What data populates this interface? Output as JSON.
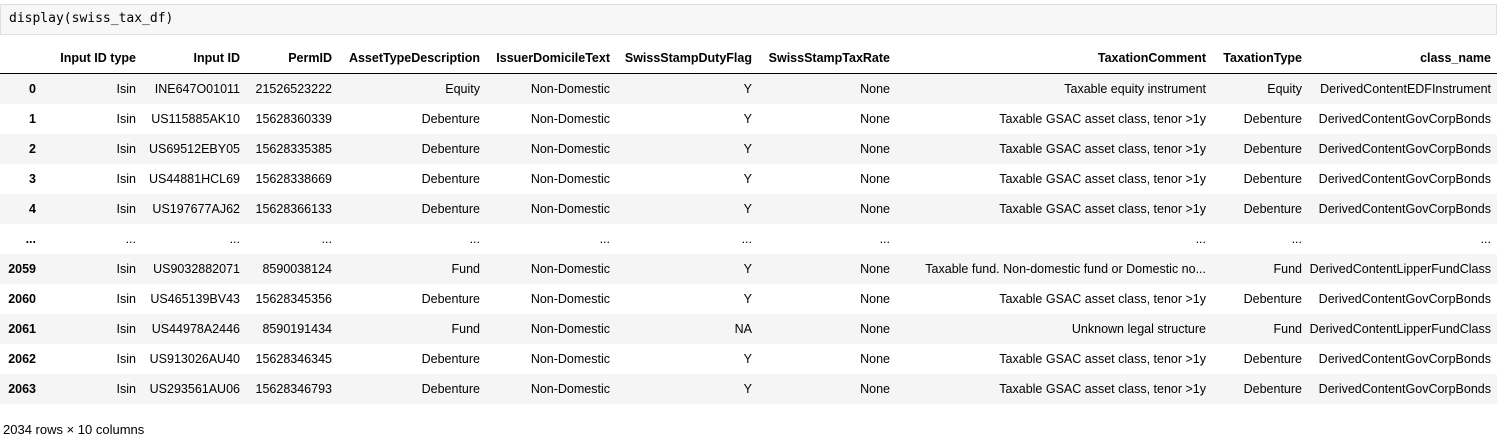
{
  "cell": {
    "code": "display(swiss_tax_df)"
  },
  "table": {
    "columns": [
      "",
      "Input ID type",
      "Input ID",
      "PermID",
      "AssetTypeDescription",
      "IssuerDomicileText",
      "SwissStampDutyFlag",
      "SwissStampTaxRate",
      "TaxationComment",
      "TaxationType",
      "class_name"
    ],
    "rows": [
      [
        "0",
        "Isin",
        "INE647O01011",
        "21526523222",
        "Equity",
        "Non-Domestic",
        "Y",
        "None",
        "Taxable equity instrument",
        "Equity",
        "DerivedContentEDFInstrument"
      ],
      [
        "1",
        "Isin",
        "US115885AK10",
        "15628360339",
        "Debenture",
        "Non-Domestic",
        "Y",
        "None",
        "Taxable GSAC asset class, tenor >1y",
        "Debenture",
        "DerivedContentGovCorpBonds"
      ],
      [
        "2",
        "Isin",
        "US69512EBY05",
        "15628335385",
        "Debenture",
        "Non-Domestic",
        "Y",
        "None",
        "Taxable GSAC asset class, tenor >1y",
        "Debenture",
        "DerivedContentGovCorpBonds"
      ],
      [
        "3",
        "Isin",
        "US44881HCL69",
        "15628338669",
        "Debenture",
        "Non-Domestic",
        "Y",
        "None",
        "Taxable GSAC asset class, tenor >1y",
        "Debenture",
        "DerivedContentGovCorpBonds"
      ],
      [
        "4",
        "Isin",
        "US197677AJ62",
        "15628366133",
        "Debenture",
        "Non-Domestic",
        "Y",
        "None",
        "Taxable GSAC asset class, tenor >1y",
        "Debenture",
        "DerivedContentGovCorpBonds"
      ],
      [
        "...",
        "...",
        "...",
        "...",
        "...",
        "...",
        "...",
        "...",
        "...",
        "...",
        "..."
      ],
      [
        "2059",
        "Isin",
        "US9032882071",
        "8590038124",
        "Fund",
        "Non-Domestic",
        "Y",
        "None",
        "Taxable fund. Non-domestic fund or Domestic no...",
        "Fund",
        "DerivedContentLipperFundClass"
      ],
      [
        "2060",
        "Isin",
        "US465139BV43",
        "15628345356",
        "Debenture",
        "Non-Domestic",
        "Y",
        "None",
        "Taxable GSAC asset class, tenor >1y",
        "Debenture",
        "DerivedContentGovCorpBonds"
      ],
      [
        "2061",
        "Isin",
        "US44978A2446",
        "8590191434",
        "Fund",
        "Non-Domestic",
        "NA",
        "None",
        "Unknown legal structure",
        "Fund",
        "DerivedContentLipperFundClass"
      ],
      [
        "2062",
        "Isin",
        "US913026AU40",
        "15628346345",
        "Debenture",
        "Non-Domestic",
        "Y",
        "None",
        "Taxable GSAC asset class, tenor >1y",
        "Debenture",
        "DerivedContentGovCorpBonds"
      ],
      [
        "2063",
        "Isin",
        "US293561AU06",
        "15628346793",
        "Debenture",
        "Non-Domestic",
        "Y",
        "None",
        "Taxable GSAC asset class, tenor >1y",
        "Debenture",
        "DerivedContentGovCorpBonds"
      ]
    ]
  },
  "footer": {
    "shape_text": "2034 rows × 10 columns"
  }
}
